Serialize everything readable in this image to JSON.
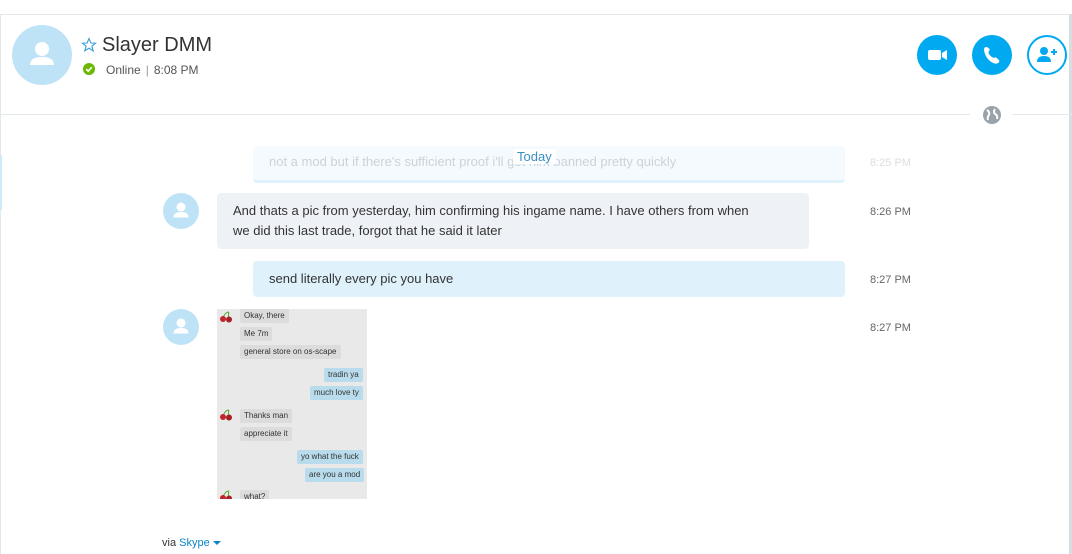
{
  "header": {
    "contact_name": "Slayer DMM",
    "status": "Online",
    "status_separator": "|",
    "status_time": "8:08 PM",
    "buttons": {
      "video": "video-call",
      "call": "audio-call",
      "add": "add-people"
    }
  },
  "colors": {
    "accent": "#00a9f0",
    "online": "#6bb700",
    "incoming_bubble": "#eef2f6",
    "outgoing_bubble": "#dff1fb",
    "avatar": "#bfe3f6"
  },
  "conversation": {
    "date_divider": "Today",
    "ghost_message": {
      "text": "not a mod but if there's sufficient proof i'll get him banned pretty quickly",
      "time": "8:25 PM"
    },
    "messages": [
      {
        "direction": "incoming",
        "line1": "And thats a pic from yesterday, him confirming his ingame name. I have others from when",
        "line2": "we did this last trade, forgot that he said it later",
        "time": "8:26 PM"
      },
      {
        "direction": "outgoing",
        "text": "send literally every pic you have",
        "time": "8:27 PM"
      },
      {
        "direction": "incoming",
        "type": "image",
        "time": "8:27 PM"
      }
    ]
  },
  "screenshot": {
    "lines": [
      {
        "dir": "in",
        "text": "Okay, there"
      },
      {
        "dir": "in",
        "text": "Me 7m"
      },
      {
        "dir": "in",
        "text": "general store on os-scape"
      },
      {
        "dir": "out",
        "text": "tradin ya"
      },
      {
        "dir": "out",
        "text": "much love ty"
      },
      {
        "dir": "in",
        "text": "Thanks man"
      },
      {
        "dir": "in",
        "text": "appreciate it"
      },
      {
        "dir": "out",
        "text": "yo what the fuck"
      },
      {
        "dir": "out",
        "text": "are you a mod"
      },
      {
        "dir": "in",
        "text": "what?"
      }
    ]
  },
  "footer": {
    "via_label": "via",
    "via_link": "Skype"
  }
}
